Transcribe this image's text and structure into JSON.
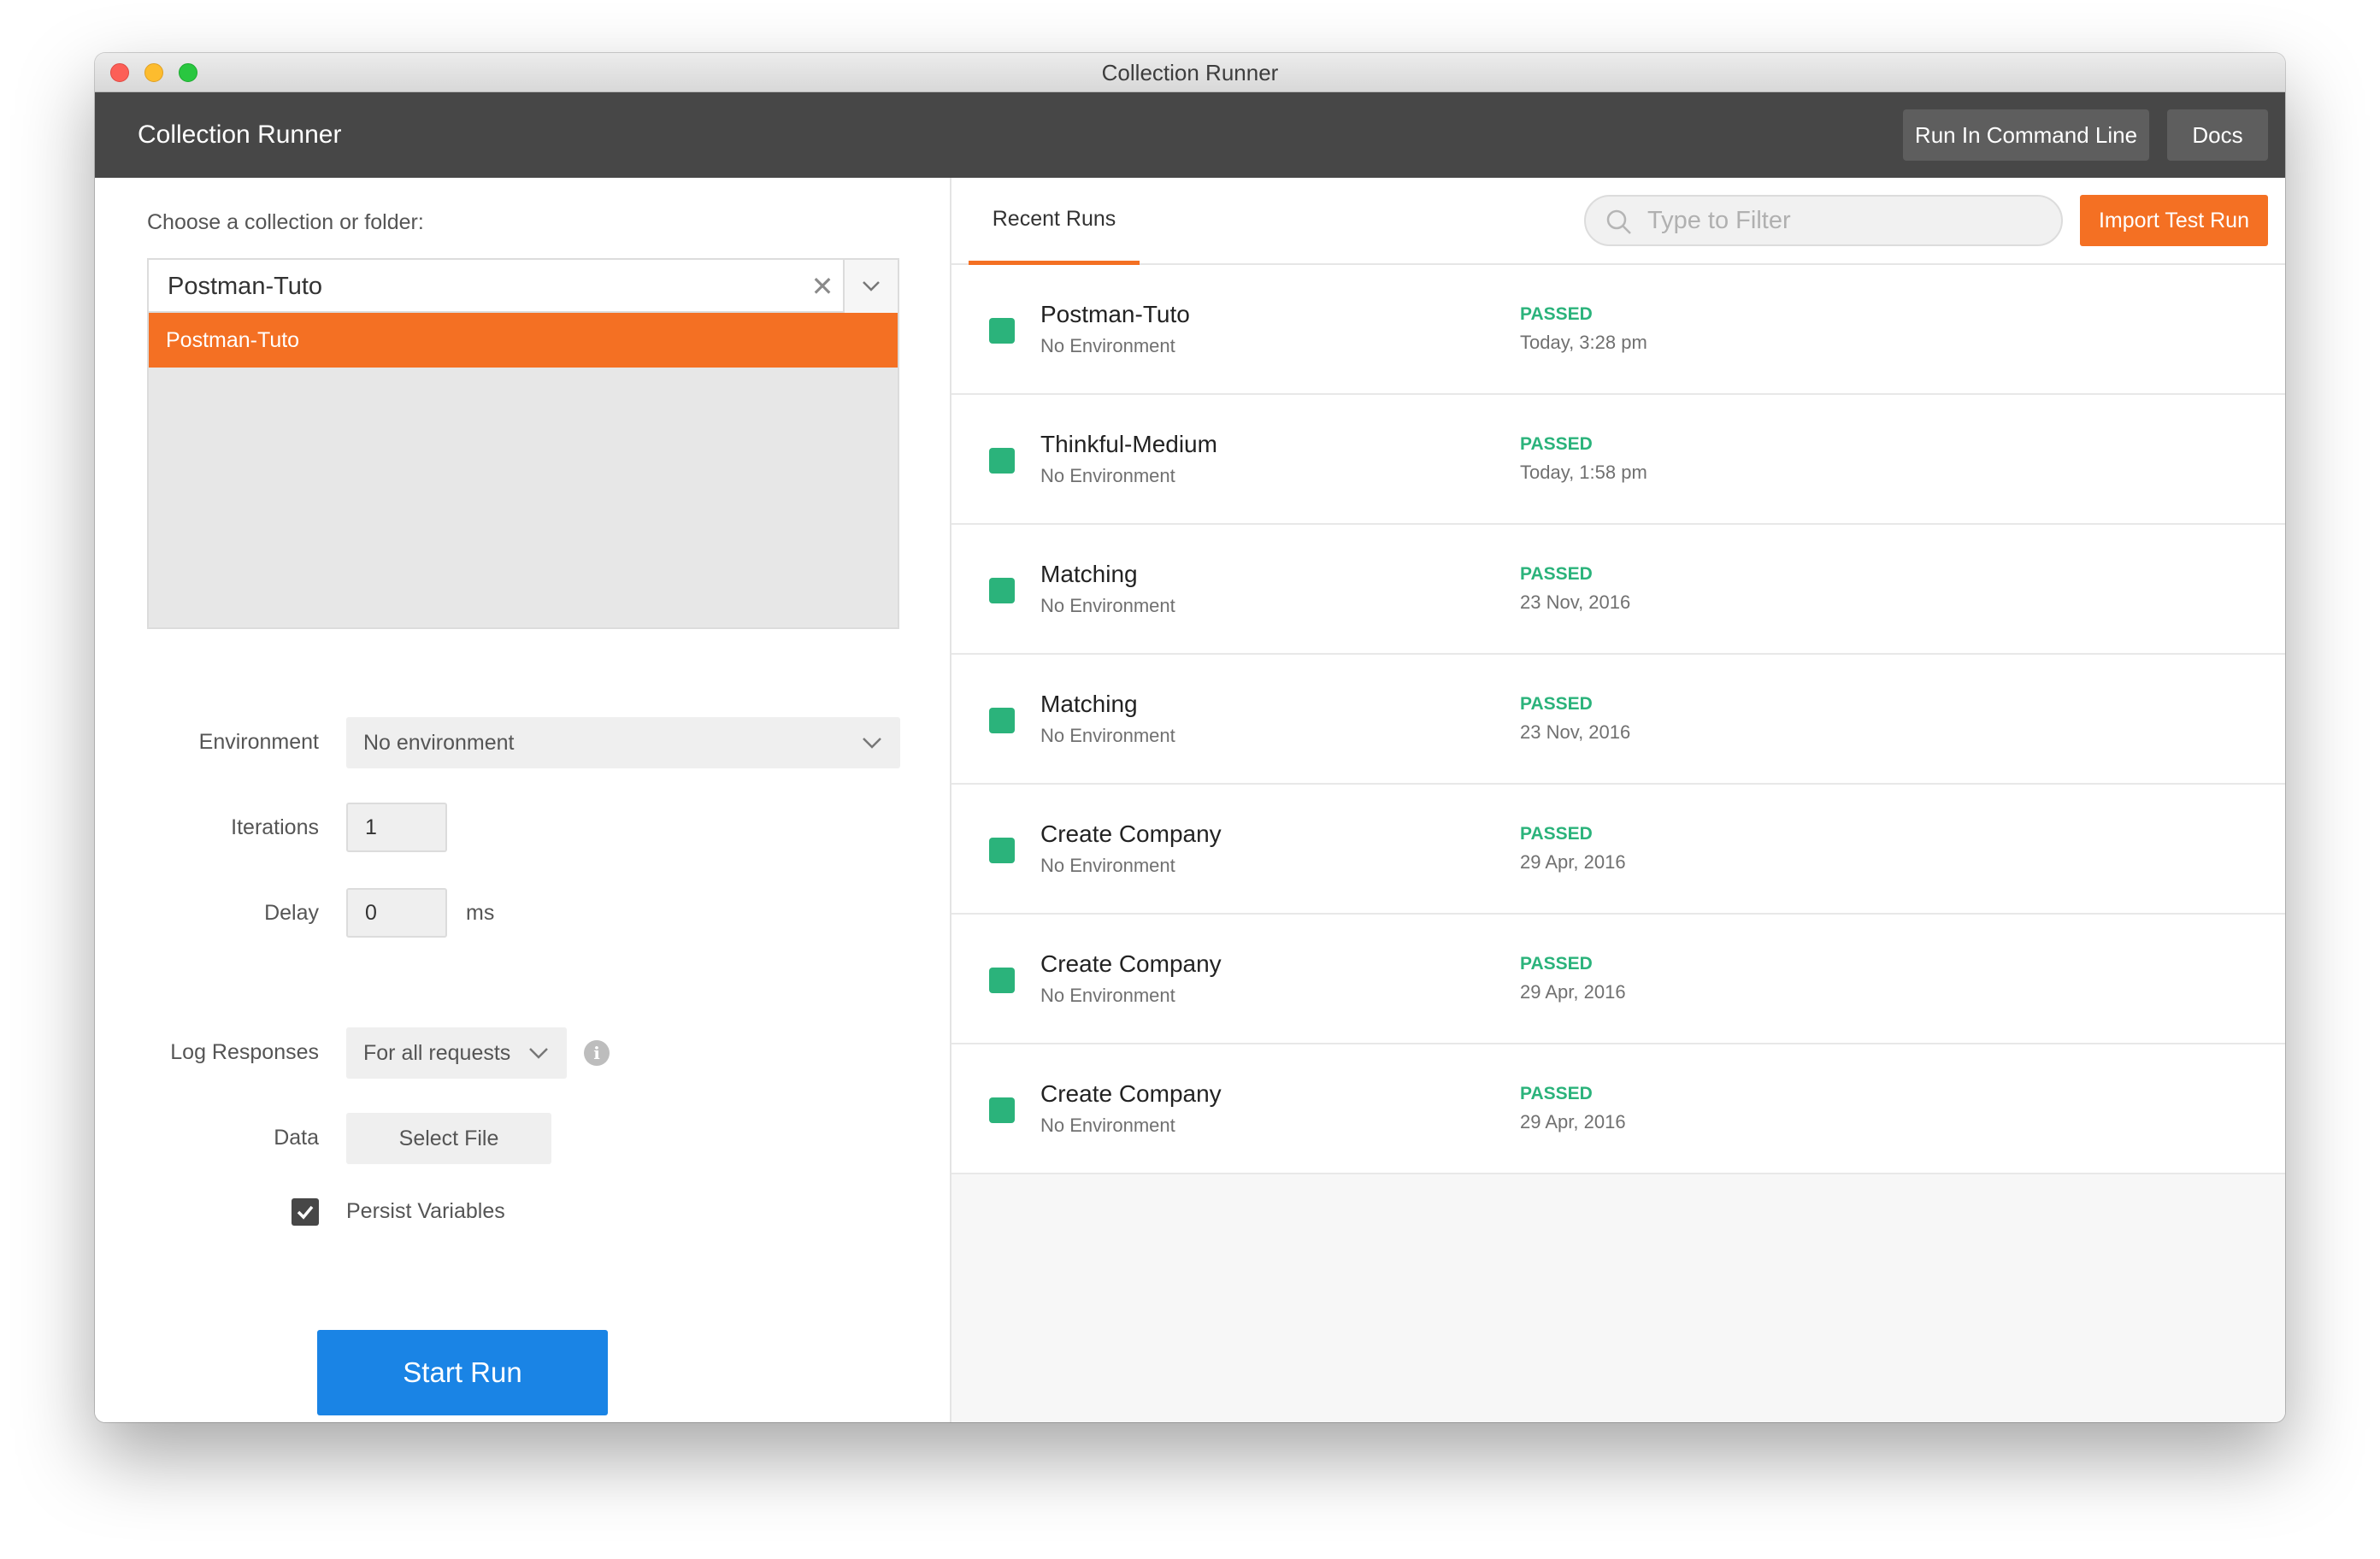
{
  "window": {
    "title": "Collection Runner"
  },
  "header": {
    "title": "Collection Runner",
    "run_cmd_label": "Run In Command Line",
    "docs_label": "Docs"
  },
  "form": {
    "choose_label": "Choose a collection or folder:",
    "selected_collection": "Postman-Tuto",
    "list_options": [
      "Postman-Tuto"
    ],
    "environment": {
      "label": "Environment",
      "value": "No environment"
    },
    "iterations": {
      "label": "Iterations",
      "value": "1"
    },
    "delay": {
      "label": "Delay",
      "value": "0",
      "unit": "ms"
    },
    "log_responses": {
      "label": "Log Responses",
      "value": "For all requests"
    },
    "data": {
      "label": "Data",
      "button": "Select File"
    },
    "persist_variables": {
      "label": "Persist Variables",
      "checked": true
    },
    "start_label": "Start Run"
  },
  "recent": {
    "tab_label": "Recent Runs",
    "filter_placeholder": "Type to Filter",
    "import_label": "Import Test Run",
    "runs": [
      {
        "name": "Postman-Tuto",
        "env": "No Environment",
        "status": "PASSED",
        "date": "Today, 3:28 pm"
      },
      {
        "name": "Thinkful-Medium",
        "env": "No Environment",
        "status": "PASSED",
        "date": "Today, 1:58 pm"
      },
      {
        "name": "Matching",
        "env": "No Environment",
        "status": "PASSED",
        "date": "23 Nov, 2016"
      },
      {
        "name": "Matching",
        "env": "No Environment",
        "status": "PASSED",
        "date": "23 Nov, 2016"
      },
      {
        "name": "Create Company",
        "env": "No Environment",
        "status": "PASSED",
        "date": "29 Apr, 2016"
      },
      {
        "name": "Create Company",
        "env": "No Environment",
        "status": "PASSED",
        "date": "29 Apr, 2016"
      },
      {
        "name": "Create Company",
        "env": "No Environment",
        "status": "PASSED",
        "date": "29 Apr, 2016"
      }
    ]
  },
  "colors": {
    "accent": "#f47023",
    "primary": "#1a84e5",
    "passed": "#2bb37b",
    "header_bg": "#474747"
  }
}
